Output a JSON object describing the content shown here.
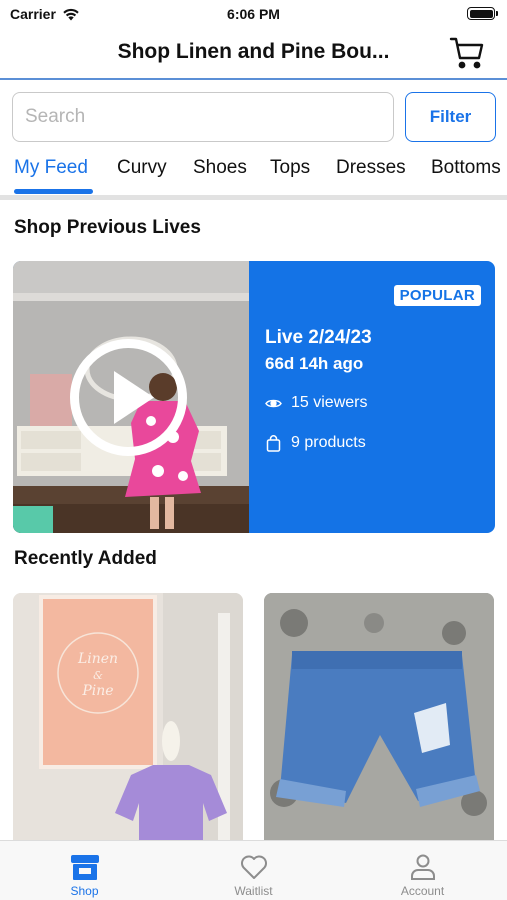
{
  "status_bar": {
    "carrier": "Carrier",
    "time": "6:06 PM",
    "battery_level": 1.0
  },
  "header": {
    "title": "Shop Linen and Pine Bou...",
    "cart_icon": "cart-icon"
  },
  "search": {
    "placeholder": "Search",
    "value": ""
  },
  "filter": {
    "label": "Filter"
  },
  "tabs": [
    {
      "label": "My Feed",
      "active": true
    },
    {
      "label": "Curvy"
    },
    {
      "label": "Shoes"
    },
    {
      "label": "Tops"
    },
    {
      "label": "Dresses"
    },
    {
      "label": "Bottoms"
    }
  ],
  "sections": {
    "previous_lives": "Shop Previous Lives",
    "recently_added": "Recently Added"
  },
  "live": {
    "badge": "POPULAR",
    "title": "Live 2/24/23",
    "ago": "66d 14h ago",
    "viewers": "15 viewers",
    "products": "9 products",
    "accent_color": "#1473e6"
  },
  "products": [
    {
      "logo_text": [
        "Linen",
        "&",
        "Pine"
      ]
    },
    {}
  ],
  "tab_bar": [
    {
      "label": "Shop",
      "icon": "store-icon",
      "active": true
    },
    {
      "label": "Waitlist",
      "icon": "heart-icon"
    },
    {
      "label": "Account",
      "icon": "person-icon"
    }
  ],
  "colors": {
    "accent": "#1a73e8",
    "header_line": "#5b8fd6"
  }
}
